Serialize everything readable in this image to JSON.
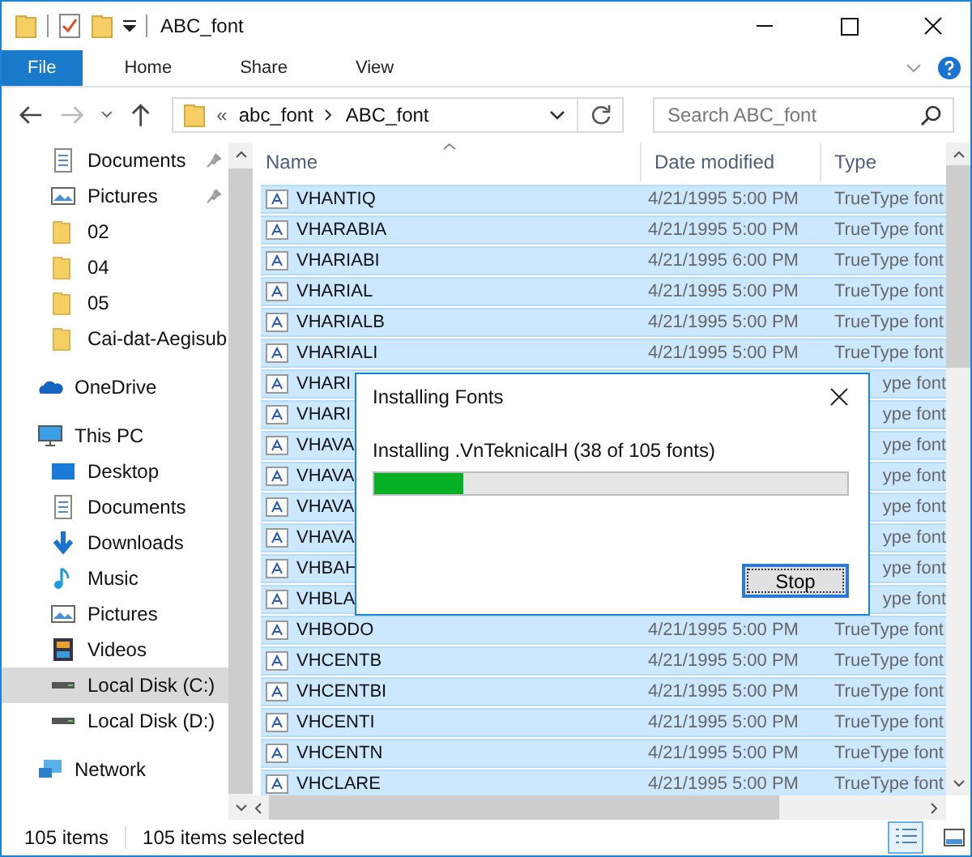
{
  "window": {
    "title": "ABC_font"
  },
  "ribbon_tabs": [
    {
      "label": "File",
      "selected": true
    },
    {
      "label": "Home",
      "selected": false
    },
    {
      "label": "Share",
      "selected": false
    },
    {
      "label": "View",
      "selected": false
    }
  ],
  "address": {
    "overflow": "«",
    "crumbs": [
      "abc_font",
      "ABC_font"
    ]
  },
  "search": {
    "placeholder": "Search ABC_font"
  },
  "sidebar": {
    "items": [
      {
        "label": "Documents",
        "pinned": true,
        "selected": false
      },
      {
        "label": "Pictures",
        "pinned": true,
        "selected": false
      },
      {
        "label": "02",
        "pinned": false,
        "selected": false
      },
      {
        "label": "04",
        "pinned": false,
        "selected": false
      },
      {
        "label": "05",
        "pinned": false,
        "selected": false
      },
      {
        "label": "Cai-dat-Aegisub",
        "pinned": false,
        "selected": false
      },
      {
        "label": "OneDrive",
        "pinned": false,
        "selected": false
      },
      {
        "label": "This PC",
        "pinned": false,
        "selected": false
      },
      {
        "label": "Desktop",
        "pinned": false,
        "selected": false
      },
      {
        "label": "Documents",
        "pinned": false,
        "selected": false
      },
      {
        "label": "Downloads",
        "pinned": false,
        "selected": false
      },
      {
        "label": "Music",
        "pinned": false,
        "selected": false
      },
      {
        "label": "Pictures",
        "pinned": false,
        "selected": false
      },
      {
        "label": "Videos",
        "pinned": false,
        "selected": false
      },
      {
        "label": "Local Disk (C:)",
        "pinned": false,
        "selected": true
      },
      {
        "label": "Local Disk (D:)",
        "pinned": false,
        "selected": false
      },
      {
        "label": "Network",
        "pinned": false,
        "selected": false
      }
    ]
  },
  "table": {
    "columns": [
      "Name",
      "Date modified",
      "Type"
    ],
    "rows": [
      {
        "kind": "full",
        "name": "VHANTIQ",
        "date": "4/21/1995 5:00 PM",
        "type": "TrueType font",
        "selected": true
      },
      {
        "kind": "full",
        "name": "VHARABIA",
        "date": "4/21/1995 5:00 PM",
        "type": "TrueType font",
        "selected": true
      },
      {
        "kind": "full",
        "name": "VHARIABI",
        "date": "4/21/1995 6:00 PM",
        "type": "TrueType font",
        "selected": true
      },
      {
        "kind": "full",
        "name": "VHARIAL",
        "date": "4/21/1995 5:00 PM",
        "type": "TrueType font",
        "selected": true
      },
      {
        "kind": "full",
        "name": "VHARIALB",
        "date": "4/21/1995 5:00 PM",
        "type": "TrueType font",
        "selected": true
      },
      {
        "kind": "full",
        "name": "VHARIALI",
        "date": "4/21/1995 5:00 PM",
        "type": "TrueType font",
        "selected": true
      },
      {
        "kind": "covered",
        "name": "VHARI",
        "type": "ype font",
        "selected": true
      },
      {
        "kind": "covered",
        "name": "VHARI",
        "type": "ype font",
        "selected": true
      },
      {
        "kind": "covered",
        "name": "VHAVA",
        "type": "ype font",
        "selected": true
      },
      {
        "kind": "covered",
        "name": "VHAVA",
        "type": "ype font",
        "selected": true
      },
      {
        "kind": "covered",
        "name": "VHAVA",
        "type": "ype font",
        "selected": true
      },
      {
        "kind": "covered",
        "name": "VHAVA",
        "type": "ype font",
        "selected": true
      },
      {
        "kind": "covered",
        "name": "VHBAH",
        "type": "ype font",
        "selected": true
      },
      {
        "kind": "covered",
        "name": "VHBLA",
        "type": "ype font",
        "selected": true
      },
      {
        "kind": "full",
        "name": "VHBODO",
        "date": "4/21/1995 5:00 PM",
        "type": "TrueType font",
        "selected": true
      },
      {
        "kind": "full",
        "name": "VHCENTB",
        "date": "4/21/1995 5:00 PM",
        "type": "TrueType font",
        "selected": true
      },
      {
        "kind": "full",
        "name": "VHCENTBI",
        "date": "4/21/1995 5:00 PM",
        "type": "TrueType font",
        "selected": true
      },
      {
        "kind": "full",
        "name": "VHCENTI",
        "date": "4/21/1995 5:00 PM",
        "type": "TrueType font",
        "selected": true
      },
      {
        "kind": "full",
        "name": "VHCENTN",
        "date": "4/21/1995 5:00 PM",
        "type": "TrueType font",
        "selected": true
      },
      {
        "kind": "full",
        "name": "VHCLARE",
        "date": "4/21/1995 5:00 PM",
        "type": "TrueType font",
        "selected": true
      }
    ]
  },
  "status_bar": {
    "count": "105 items",
    "selected": "105 items selected"
  },
  "dialog": {
    "title": "Installing Fonts",
    "message": "Installing .VnTeknicalH (38 of 105 fonts)",
    "progress": {
      "level": 0.19
    },
    "button": "Stop"
  }
}
